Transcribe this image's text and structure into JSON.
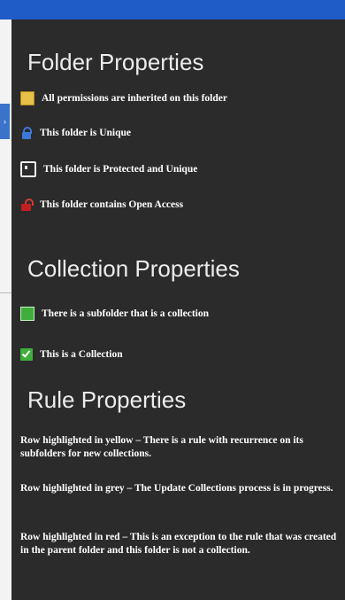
{
  "folder_properties": {
    "title": "Folder Properties",
    "items": [
      {
        "icon": "folder-yellow-icon",
        "label": "All permissions are inherited on this folder"
      },
      {
        "icon": "lock-blue-icon",
        "label": "This folder is Unique"
      },
      {
        "icon": "protected-document-icon",
        "label": "This folder is Protected and Unique"
      },
      {
        "icon": "lock-red-icon",
        "label": "This folder contains Open Access"
      }
    ]
  },
  "collection_properties": {
    "title": "Collection Properties",
    "items": [
      {
        "icon": "green-folder-icon",
        "label": "There is a subfolder that is a collection"
      },
      {
        "icon": "green-check-icon",
        "label": "This is a Collection"
      }
    ]
  },
  "rule_properties": {
    "title": "Rule Properties",
    "paragraphs": [
      "Row highlighted in yellow – There is a rule with recurrence on its subfolders for new collections.",
      "Row highlighted in grey – The Update Collections process is in progress.",
      "Row highlighted in red – This is an exception to the rule that was created in the parent folder and this folder is not a collection."
    ]
  },
  "colors": {
    "top_bar": "#1f5cc8",
    "panel_bg": "#2b2b2b",
    "text": "#ffffff"
  }
}
